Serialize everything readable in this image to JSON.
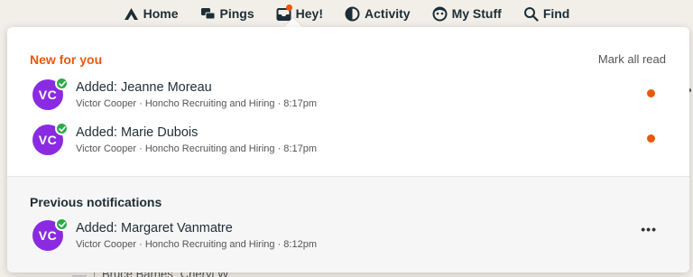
{
  "nav": {
    "items": [
      {
        "label": "Home",
        "icon": "home-icon"
      },
      {
        "label": "Pings",
        "icon": "pings-icon"
      },
      {
        "label": "Hey!",
        "icon": "hey-inbox-icon"
      },
      {
        "label": "Activity",
        "icon": "activity-icon"
      },
      {
        "label": "My Stuff",
        "icon": "my-stuff-icon"
      },
      {
        "label": "Find",
        "icon": "search-icon"
      }
    ]
  },
  "notifications": {
    "new_title": "New for you",
    "mark_all_label": "Mark all read",
    "new_items": [
      {
        "avatar": "VC",
        "title": "Added: Jeanne Moreau",
        "meta": "Victor Cooper · Honcho Recruiting and Hiring · 8:17pm"
      },
      {
        "avatar": "VC",
        "title": "Added: Marie Dubois",
        "meta": "Victor Cooper · Honcho Recruiting and Hiring · 8:17pm"
      }
    ],
    "previous_title": "Previous notifications",
    "previous_items": [
      {
        "avatar": "VC",
        "title": "Added: Margaret Vanmatre",
        "meta": "Victor Cooper · Honcho Recruiting and Hiring · 8:12pm",
        "more": "•••"
      }
    ]
  },
  "background": {
    "row_text": "Bruce Barnes",
    "row_sub": "Cheryl W"
  },
  "colors": {
    "accent": "#e8590c",
    "avatar": "#8a2be2",
    "check_badge": "#2ea84a"
  }
}
